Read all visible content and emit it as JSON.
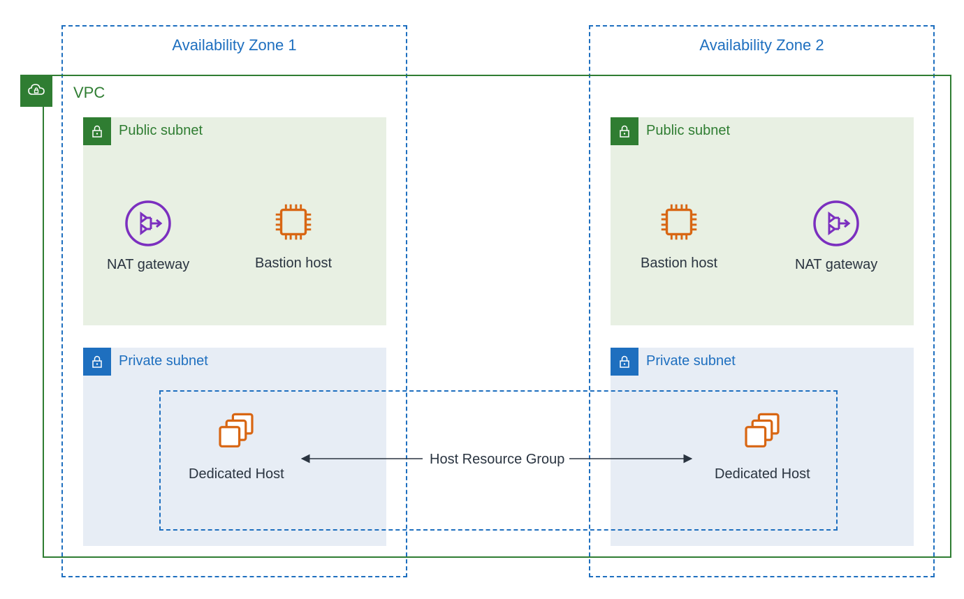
{
  "az1_label": "Availability Zone 1",
  "az2_label": "Availability Zone 2",
  "vpc_label": "VPC",
  "public_subnet_label": "Public subnet",
  "private_subnet_label": "Private subnet",
  "resources": {
    "nat_gateway": "NAT gateway",
    "bastion_host": "Bastion host",
    "dedicated_host": "Dedicated Host"
  },
  "host_resource_group_label": "Host Resource Group",
  "colors": {
    "blue": "#1E6FBF",
    "green": "#2F7D32",
    "orange": "#D86613",
    "purple": "#7B2FBF",
    "text": "#2A3440",
    "public_fill": "#E8F0E3",
    "private_fill": "#E7EDF5"
  }
}
